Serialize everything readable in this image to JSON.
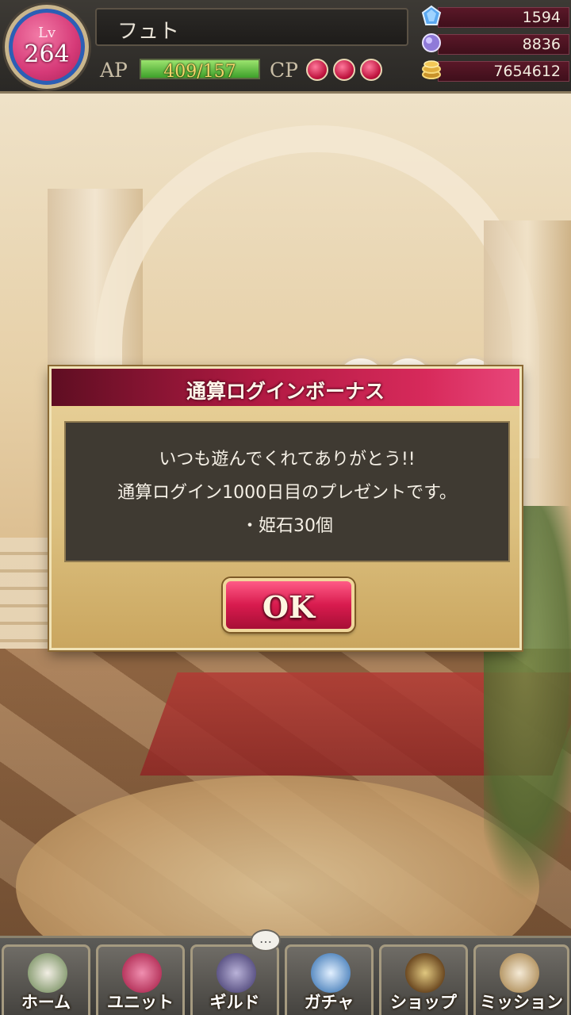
{
  "status": {
    "level_label": "Lv",
    "level": "264",
    "player_name": "フュト",
    "ap_label": "AP",
    "ap_text": "409/157",
    "ap_fill_fraction": 1.0,
    "cp_label": "CP",
    "cp_count": 3,
    "currencies": [
      {
        "icon": "blue-gem-icon",
        "value": "1594"
      },
      {
        "icon": "purple-gem-icon",
        "value": "8836"
      },
      {
        "icon": "gold-coin-icon",
        "value": "7654612"
      }
    ]
  },
  "dialog": {
    "title": "通算ログインボーナス",
    "lines": [
      "いつも遊んでくれてありがとう!!",
      "通算ログイン1000日目のプレゼントです。",
      "・姫石30個"
    ],
    "ok_label": "OK"
  },
  "nav": {
    "items": [
      {
        "label": "ホーム",
        "icon": "home-crest-icon"
      },
      {
        "label": "ユニット",
        "icon": "unit-swords-icon"
      },
      {
        "label": "ギルド",
        "icon": "guild-castle-icon"
      },
      {
        "label": "ガチャ",
        "icon": "gacha-crystal-icon"
      },
      {
        "label": "ショップ",
        "icon": "shop-sign-icon"
      },
      {
        "label": "ミッション",
        "icon": "mission-scroll-icon"
      }
    ],
    "guild_chat_icon": "chat-bubble-icon",
    "guild_chat_text": "…"
  },
  "colors": {
    "accent_pink": "#d81b4e",
    "header_crimson": "#b21a43",
    "dialog_gold": "#dcc07f",
    "body_dark": "#3f3a32"
  }
}
